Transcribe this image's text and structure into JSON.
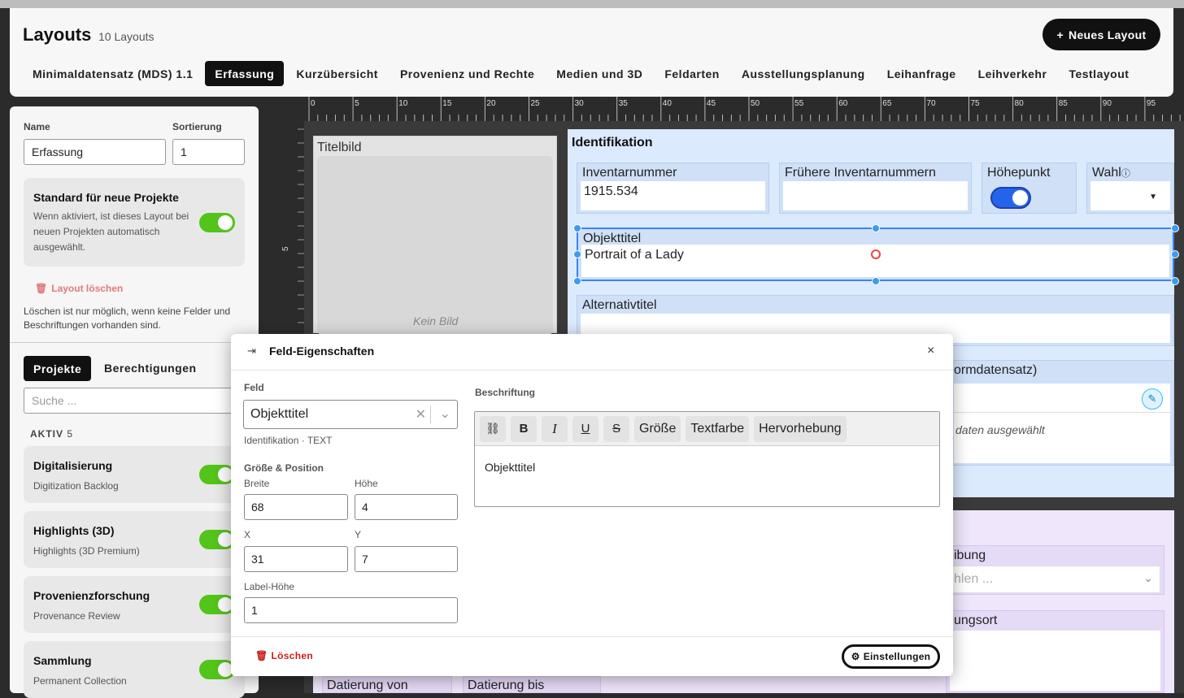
{
  "header": {
    "title": "Layouts",
    "count": "10 Layouts",
    "new_button": "Neues Layout"
  },
  "tabs": [
    "Minimaldatensatz (MDS) 1.1",
    "Erfassung",
    "Kurzübersicht",
    "Provenienz und Rechte",
    "Medien und 3D",
    "Feldarten",
    "Ausstellungsplanung",
    "Leihanfrage",
    "Leihverkehr",
    "Testlayout"
  ],
  "active_tab": "Erfassung",
  "sidebar": {
    "name_label": "Name",
    "name_value": "Erfassung",
    "sort_label": "Sortierung",
    "sort_value": "1",
    "std_title": "Standard für neue Projekte",
    "std_desc": "Wenn aktiviert, ist dieses Layout bei neuen Projekten automatisch ausgewählt.",
    "delete_label": "Layout löschen",
    "delete_note": "Löschen ist nur möglich, wenn keine Felder und Beschriftungen vorhanden sind.",
    "subtab_projects": "Projekte",
    "subtab_permissions": "Berechtigungen",
    "search_placeholder": "Suche ...",
    "active_label": "AKTIV",
    "active_count": "5",
    "projects": [
      {
        "title": "Digitalisierung",
        "sub": "Digitization Backlog"
      },
      {
        "title": "Highlights (3D)",
        "sub": "Highlights (3D Premium)"
      },
      {
        "title": "Provenienzforschung",
        "sub": "Provenance Review"
      },
      {
        "title": "Sammlung",
        "sub": "Permanent Collection"
      }
    ]
  },
  "ruler": [
    "0",
    "5",
    "10",
    "15",
    "20",
    "25",
    "30",
    "35",
    "40",
    "45",
    "50",
    "55",
    "60",
    "65",
    "70",
    "75",
    "80",
    "85",
    "90",
    "95"
  ],
  "vruler_label": "5",
  "canvas": {
    "titelbild_label": "Titelbild",
    "titelbild_empty": "Kein Bild",
    "group_title": "Identifikation",
    "inventarnummer_label": "Inventarnummer",
    "inventarnummer_value": "1915.534",
    "fruehere_label": "Frühere Inventarnummern",
    "hoehepunkt_label": "Höhepunkt",
    "wahl_label": "Wahl",
    "objekttitel_label": "Objekttitel",
    "objekttitel_value": "Portrait of a Lady",
    "alternativtitel_label": "Alternativtitel",
    "normdaten_label": "ormdatensatz)",
    "normdaten_empty": "daten ausgewählt",
    "ibung_label": "ibung",
    "ibung_placeholder": "hlen ...",
    "ungsort_label": "ungsort",
    "datierung_von": "Datierung von",
    "datierung_bis": "Datierung bis"
  },
  "modal": {
    "title": "Feld-Eigenschaften",
    "close": "×",
    "feld_label": "Feld",
    "feld_value": "Objekttitel",
    "feld_meta": "Identifikation · TEXT",
    "size_label": "Größe & Position",
    "breite_label": "Breite",
    "breite_value": "68",
    "hoehe_label": "Höhe",
    "hoehe_value": "4",
    "x_label": "X",
    "x_value": "31",
    "y_label": "Y",
    "y_value": "7",
    "labelhoehe_label": "Label-Höhe",
    "labelhoehe_value": "1",
    "beschriftung_label": "Beschriftung",
    "toolbar": {
      "size": "Größe",
      "color": "Textfarbe",
      "highlight": "Hervorhebung"
    },
    "editor_value": "Objekttitel",
    "delete": "Löschen",
    "settings": "Einstellungen"
  }
}
